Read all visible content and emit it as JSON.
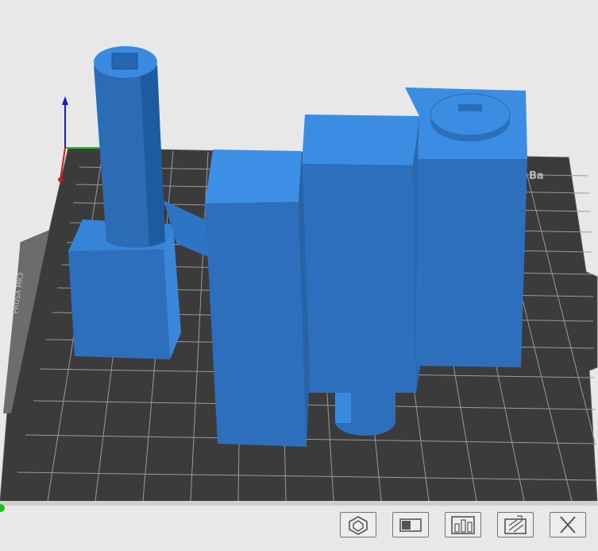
{
  "scene": {
    "bed_label_top": "Ba",
    "bed_label_side": "PRUSA MK3",
    "bed_color": "#3b3b3b",
    "grid_color": "#9a9a9a",
    "model_color": "#3584d8",
    "model_dark": "#2b6cb5",
    "background": "#e8e8e8"
  },
  "axes": {
    "x_color": "#d61a1a",
    "y_color": "#17c317",
    "z_color": "#1a1ad6"
  },
  "toolbar": {
    "icons": [
      "object-view-icon",
      "cut-icon",
      "arrange-icon",
      "layers-icon",
      "close-icon"
    ]
  }
}
